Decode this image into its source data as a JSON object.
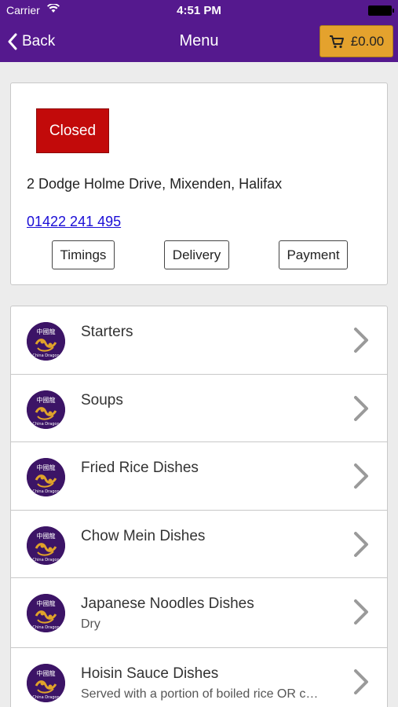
{
  "status_bar": {
    "carrier": "Carrier",
    "time": "4:51 PM"
  },
  "nav": {
    "back_label": "Back",
    "title": "Menu",
    "cart_total": "£0.00"
  },
  "restaurant": {
    "status": "Closed",
    "address": "2 Dodge Holme Drive, Mixenden, Halifax",
    "phone": "01422 241 495",
    "buttons": {
      "timings": "Timings",
      "delivery": "Delivery",
      "payment": "Payment"
    }
  },
  "categories": [
    {
      "name": "Starters",
      "subtitle": ""
    },
    {
      "name": "Soups",
      "subtitle": ""
    },
    {
      "name": "Fried Rice Dishes",
      "subtitle": ""
    },
    {
      "name": "Chow Mein Dishes",
      "subtitle": ""
    },
    {
      "name": "Japanese Noodles Dishes",
      "subtitle": "Dry"
    },
    {
      "name": "Hoisin Sauce Dishes",
      "subtitle": "Served with a portion of boiled rice OR c…"
    }
  ],
  "colors": {
    "header": "#55198e",
    "cart": "#e4a22d",
    "closed": "#c20a0a",
    "link": "#1a0dd6"
  }
}
